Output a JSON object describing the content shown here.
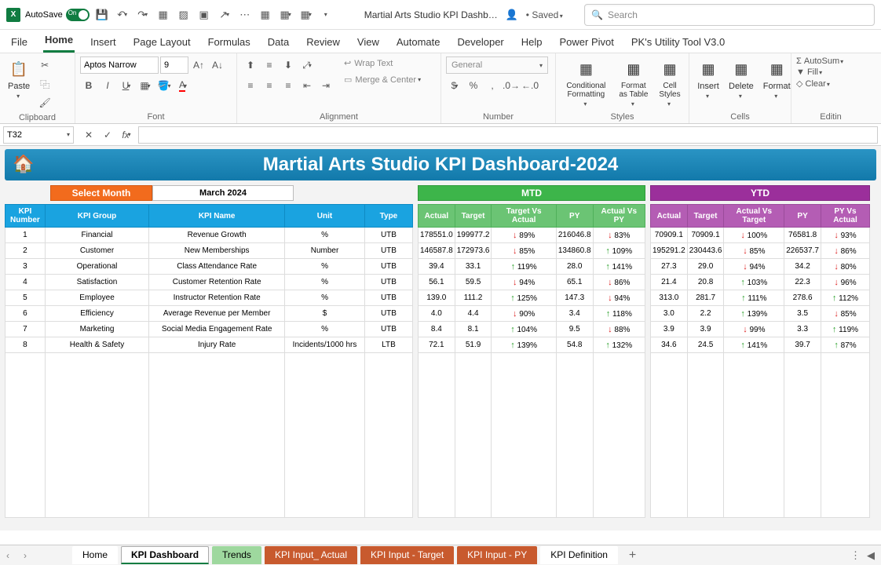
{
  "titlebar": {
    "autosave_label": "AutoSave",
    "autosave_state": "On",
    "doc_title": "Martial Arts Studio KPI Dashb…",
    "saved_status": "Saved",
    "search_placeholder": "Search"
  },
  "ribbon_tabs": [
    "File",
    "Home",
    "Insert",
    "Page Layout",
    "Formulas",
    "Data",
    "Review",
    "View",
    "Automate",
    "Developer",
    "Help",
    "Power Pivot",
    "PK's Utility Tool V3.0"
  ],
  "ribbon": {
    "paste": "Paste",
    "clipboard_label": "Clipboard",
    "font_name": "Aptos Narrow",
    "font_size": "9",
    "font_label": "Font",
    "alignment_label": "Alignment",
    "wrap_text": "Wrap Text",
    "merge_center": "Merge & Center",
    "number_format": "General",
    "number_label": "Number",
    "cond_fmt": "Conditional Formatting",
    "fmt_table": "Format as Table",
    "cell_styles": "Cell Styles",
    "styles_label": "Styles",
    "insert": "Insert",
    "delete": "Delete",
    "format": "Format",
    "cells_label": "Cells",
    "autosum": "AutoSum",
    "fill": "Fill",
    "clear": "Clear",
    "editing_label": "Editin"
  },
  "namebox": "T32",
  "dashboard": {
    "title": "Martial Arts Studio KPI Dashboard-2024",
    "select_month": "Select Month",
    "month_value": "March 2024",
    "mtd_label": "MTD",
    "ytd_label": "YTD",
    "left_headers": [
      "KPI Number",
      "KPI Group",
      "KPI Name",
      "Unit",
      "Type"
    ],
    "mtd_headers": [
      "Actual",
      "Target",
      "Target Vs Actual",
      "PY",
      "Actual Vs PY"
    ],
    "ytd_headers": [
      "Actual",
      "Target",
      "Actual Vs Target",
      "PY",
      "PY Vs Actual"
    ],
    "rows": [
      {
        "num": "1",
        "group": "Financial",
        "name": "Revenue Growth",
        "unit": "%",
        "type": "UTB",
        "mtd": {
          "actual": "178551.0",
          "target": "199977.2",
          "tvap": "89%",
          "tvad": "dn",
          "py": "216046.8",
          "avpp": "83%",
          "avpd": "dn"
        },
        "ytd": {
          "actual": "70909.1",
          "target": "70909.1",
          "avtp": "100%",
          "avtd": "dn",
          "py": "76581.8",
          "pvap": "93%",
          "pvad": "dn"
        }
      },
      {
        "num": "2",
        "group": "Customer",
        "name": "New Memberships",
        "unit": "Number",
        "type": "UTB",
        "mtd": {
          "actual": "146587.8",
          "target": "172973.6",
          "tvap": "85%",
          "tvad": "dn",
          "py": "134860.8",
          "avpp": "109%",
          "avpd": "up"
        },
        "ytd": {
          "actual": "195291.2",
          "target": "230443.6",
          "avtp": "85%",
          "avtd": "dn",
          "py": "226537.7",
          "pvap": "86%",
          "pvad": "dn"
        }
      },
      {
        "num": "3",
        "group": "Operational",
        "name": "Class Attendance Rate",
        "unit": "%",
        "type": "UTB",
        "mtd": {
          "actual": "39.4",
          "target": "33.1",
          "tvap": "119%",
          "tvad": "up",
          "py": "28.0",
          "avpp": "141%",
          "avpd": "up"
        },
        "ytd": {
          "actual": "27.3",
          "target": "29.0",
          "avtp": "94%",
          "avtd": "dn",
          "py": "34.2",
          "pvap": "80%",
          "pvad": "dn"
        }
      },
      {
        "num": "4",
        "group": "Satisfaction",
        "name": "Customer Retention Rate",
        "unit": "%",
        "type": "UTB",
        "mtd": {
          "actual": "56.1",
          "target": "59.5",
          "tvap": "94%",
          "tvad": "dn",
          "py": "65.1",
          "avpp": "86%",
          "avpd": "dn"
        },
        "ytd": {
          "actual": "21.4",
          "target": "20.8",
          "avtp": "103%",
          "avtd": "up",
          "py": "22.3",
          "pvap": "96%",
          "pvad": "dn"
        }
      },
      {
        "num": "5",
        "group": "Employee",
        "name": "Instructor Retention Rate",
        "unit": "%",
        "type": "UTB",
        "mtd": {
          "actual": "139.0",
          "target": "111.2",
          "tvap": "125%",
          "tvad": "up",
          "py": "147.3",
          "avpp": "94%",
          "avpd": "dn"
        },
        "ytd": {
          "actual": "313.0",
          "target": "281.7",
          "avtp": "111%",
          "avtd": "up",
          "py": "278.6",
          "pvap": "112%",
          "pvad": "up"
        }
      },
      {
        "num": "6",
        "group": "Efficiency",
        "name": "Average Revenue per Member",
        "unit": "$",
        "type": "UTB",
        "mtd": {
          "actual": "4.0",
          "target": "4.4",
          "tvap": "90%",
          "tvad": "dn",
          "py": "3.4",
          "avpp": "118%",
          "avpd": "up"
        },
        "ytd": {
          "actual": "3.0",
          "target": "2.2",
          "avtp": "139%",
          "avtd": "up",
          "py": "3.5",
          "pvap": "85%",
          "pvad": "dn"
        }
      },
      {
        "num": "7",
        "group": "Marketing",
        "name": "Social Media Engagement Rate",
        "unit": "%",
        "type": "UTB",
        "mtd": {
          "actual": "8.4",
          "target": "8.1",
          "tvap": "104%",
          "tvad": "up",
          "py": "9.5",
          "avpp": "88%",
          "avpd": "dn"
        },
        "ytd": {
          "actual": "3.9",
          "target": "3.9",
          "avtp": "99%",
          "avtd": "dn",
          "py": "3.3",
          "pvap": "119%",
          "pvad": "up"
        }
      },
      {
        "num": "8",
        "group": "Health & Safety",
        "name": "Injury Rate",
        "unit": "Incidents/1000 hrs",
        "type": "LTB",
        "mtd": {
          "actual": "72.1",
          "target": "51.9",
          "tvap": "139%",
          "tvad": "up",
          "py": "54.8",
          "avpp": "132%",
          "avpd": "up"
        },
        "ytd": {
          "actual": "34.6",
          "target": "24.5",
          "avtp": "141%",
          "avtd": "up",
          "py": "39.7",
          "pvap": "87%",
          "pvad": "up"
        }
      }
    ]
  },
  "sheet_tabs": [
    {
      "label": "Home",
      "cls": "plain"
    },
    {
      "label": "KPI Dashboard",
      "cls": "active"
    },
    {
      "label": "Trends",
      "cls": "green"
    },
    {
      "label": "KPI Input_ Actual",
      "cls": "orange"
    },
    {
      "label": "KPI Input - Target",
      "cls": "orange"
    },
    {
      "label": "KPI Input - PY",
      "cls": "orange"
    },
    {
      "label": "KPI Definition",
      "cls": "plain"
    }
  ]
}
